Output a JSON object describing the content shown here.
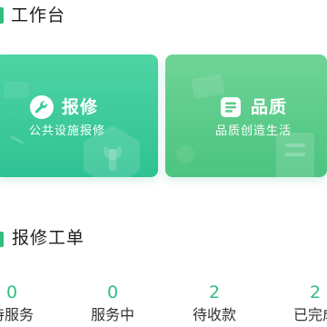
{
  "workbench": {
    "title": "工作台"
  },
  "cards": [
    {
      "id": "repair",
      "icon": "wrench-icon",
      "title": "报修",
      "subtitle": "公共设施报修",
      "color": "#3fcb9a"
    },
    {
      "id": "quality",
      "icon": "document-list-icon",
      "title": "品质",
      "subtitle": "品质创造生活",
      "color": "#5fcd8a"
    }
  ],
  "repair_orders": {
    "title": "报修工单",
    "stats": [
      {
        "count": "0",
        "label": "待服务"
      },
      {
        "count": "0",
        "label": "服务中"
      },
      {
        "count": "2",
        "label": "待收款"
      },
      {
        "count": "2",
        "label": "已完成"
      }
    ]
  },
  "colors": {
    "accent": "#2fbf7e",
    "count_text": "#2fbf7e"
  }
}
